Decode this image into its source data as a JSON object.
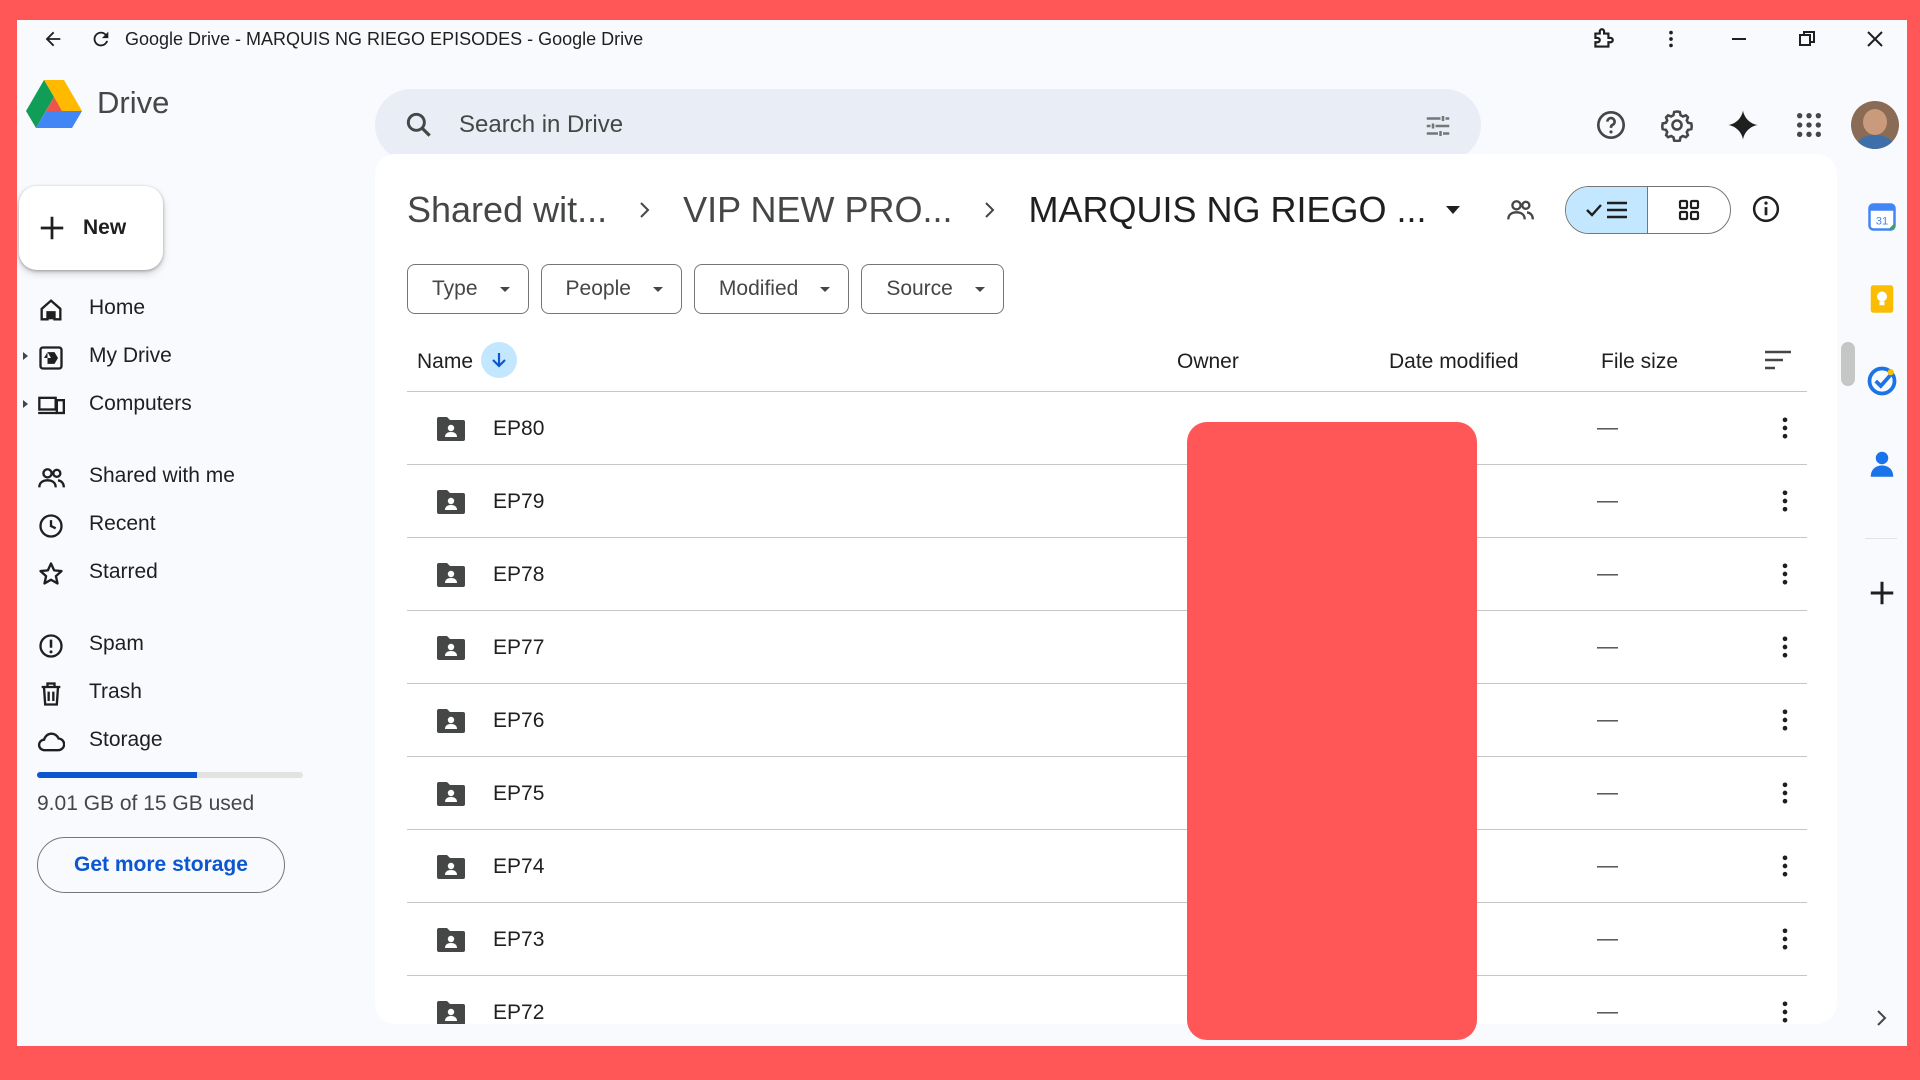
{
  "browser": {
    "title": "Google Drive - MARQUIS NG RIEGO EPISODES - Google Drive"
  },
  "app": {
    "name": "Drive"
  },
  "search": {
    "placeholder": "Search in Drive"
  },
  "sidebar": {
    "new_label": "New",
    "items": [
      {
        "label": "Home",
        "icon": "home-icon"
      },
      {
        "label": "My Drive",
        "icon": "my-drive-icon"
      },
      {
        "label": "Computers",
        "icon": "computers-icon"
      },
      {
        "label": "Shared with me",
        "icon": "shared-icon"
      },
      {
        "label": "Recent",
        "icon": "clock-icon"
      },
      {
        "label": "Starred",
        "icon": "star-icon"
      },
      {
        "label": "Spam",
        "icon": "spam-icon"
      },
      {
        "label": "Trash",
        "icon": "trash-icon"
      },
      {
        "label": "Storage",
        "icon": "cloud-icon"
      }
    ],
    "storage": {
      "used_fraction": 0.6,
      "text": "9.01 GB of 15 GB used",
      "button": "Get more storage"
    }
  },
  "breadcrumb": {
    "items": [
      "Shared wit...",
      "VIP NEW PRO...",
      "MARQUIS NG RIEGO ..."
    ]
  },
  "filters": [
    "Type",
    "People",
    "Modified",
    "Source"
  ],
  "table": {
    "columns": {
      "name": "Name",
      "owner": "Owner",
      "modified": "Date modified",
      "size": "File size"
    },
    "rows": [
      {
        "name": "EP80",
        "size": "—"
      },
      {
        "name": "EP79",
        "size": "—"
      },
      {
        "name": "EP78",
        "size": "—"
      },
      {
        "name": "EP77",
        "size": "—"
      },
      {
        "name": "EP76",
        "size": "—"
      },
      {
        "name": "EP75",
        "size": "—"
      },
      {
        "name": "EP74",
        "size": "—"
      },
      {
        "name": "EP73",
        "size": "—"
      },
      {
        "name": "EP72",
        "size": "—"
      }
    ]
  },
  "colors": {
    "accent": "#0b57d0",
    "selected": "#c2e7ff",
    "redaction": "#ff5757"
  }
}
